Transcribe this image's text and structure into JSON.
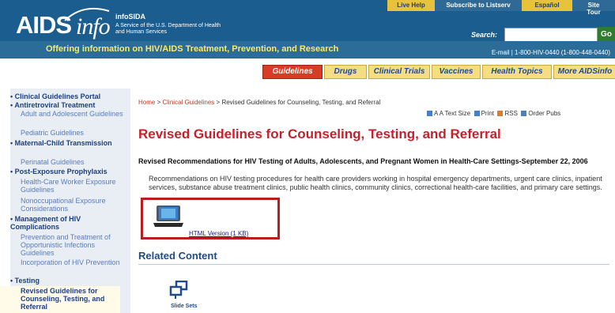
{
  "header": {
    "logo_aids": "AIDS",
    "logo_info": "info",
    "logo_sida": "infoSIDA",
    "tagline": "A Service of the U.S. Department of Health and Human Services",
    "offering": "Offering information on HIV/AIDS Treatment, Prevention, and Research",
    "phone": "E-mail  |  1-800-HIV-0440 (1-800-448-0440)",
    "top_links": {
      "live_help": "Live Help",
      "subscribe": "Subscribe to Listserv",
      "espanol": "Español",
      "site_tour": "Site Tour"
    },
    "search": {
      "label": "Search",
      "value": "",
      "button": "Go"
    }
  },
  "tabs": [
    {
      "label": "Guidelines"
    },
    {
      "label": "Drugs"
    },
    {
      "label": "Clinical Trials"
    },
    {
      "label": "Vaccines"
    },
    {
      "label": "Health Topics"
    },
    {
      "label": "More AIDSinfo"
    }
  ],
  "sidebar": {
    "items": [
      {
        "label": "Clinical Guidelines Portal"
      },
      {
        "label": "Antiretroviral Treatment"
      },
      {
        "label": "Adult and Adolescent Guidelines"
      },
      {
        "label": "Pediatric Guidelines"
      },
      {
        "label": "Maternal-Child Transmission"
      },
      {
        "label": "Perinatal Guidelines"
      },
      {
        "label": "Post-Exposure Prophylaxis"
      },
      {
        "label": "Health-Care Worker Exposure Guidelines"
      },
      {
        "label": "Nonoccupational Exposure Considerations"
      },
      {
        "label": "Management of HIV Complications"
      },
      {
        "label": "Prevention and Treatment of Opportunistic Infections Guidelines"
      },
      {
        "label": "Incorporation of HIV Prevention"
      },
      {
        "label": "Testing"
      },
      {
        "label": "Revised Guidelines for Counseling, Testing, and Referral"
      }
    ]
  },
  "main": {
    "breadcrumb": {
      "home": "Home",
      "sep": ">",
      "section": "Clinical Guidelines",
      "current": "Revised Guidelines for Counseling, Testing, and Referral"
    },
    "utilities": {
      "text_size": "A A  Text Size",
      "print": "Print",
      "rss": "RSS",
      "order": "Order Pubs"
    },
    "title": "Revised Guidelines for Counseling, Testing, and Referral",
    "sub_heading": "Revised Recommendations for HIV Testing of Adults, Adolescents, and Pregnant Women in Health-Care Settings-September 22, 2006",
    "summary": "Recommendations on HIV testing procedures for health care providers working in hospital emergency departments, urgent care clinics, inpatient services, substance abuse treatment clinics, public health clinics, community clinics, correctional health-care facilities, and primary care settings.",
    "html_version_link": "HTML Version (1 KB)",
    "related_heading": "Related Content",
    "slide_sets_label": "Slide Sets"
  },
  "colors": {
    "header_blue": "#1b5d8f",
    "accent_yellow": "#e8c23b",
    "title_red": "#c8202a",
    "highlight_border": "#b81d22"
  }
}
